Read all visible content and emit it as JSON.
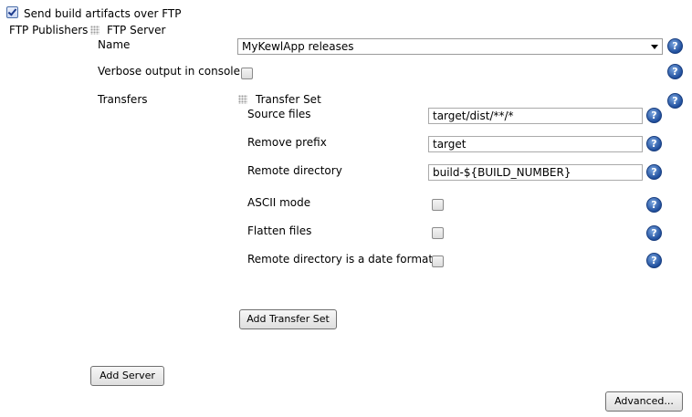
{
  "header": {
    "send_label": "Send build artifacts over FTP",
    "send_checked": true
  },
  "publishers": {
    "label": "FTP Publishers",
    "server_label": "FTP Server"
  },
  "server": {
    "name_label": "Name",
    "name_value": "MyKewlApp releases",
    "verbose_label": "Verbose output in console",
    "transfers_label": "Transfers"
  },
  "transfer_set": {
    "title": "Transfer Set",
    "source_label": "Source files",
    "source_value": "target/dist/**/*",
    "prefix_label": "Remove prefix",
    "prefix_value": "target",
    "remote_label": "Remote directory",
    "remote_value": "build-${BUILD_NUMBER}",
    "ascii_label": "ASCII mode",
    "flatten_label": "Flatten files",
    "dateformat_label": "Remote directory is a date format"
  },
  "buttons": {
    "add_transfer_set": "Add Transfer Set",
    "add_server": "Add Server",
    "advanced": "Advanced..."
  },
  "help_glyph": "?"
}
